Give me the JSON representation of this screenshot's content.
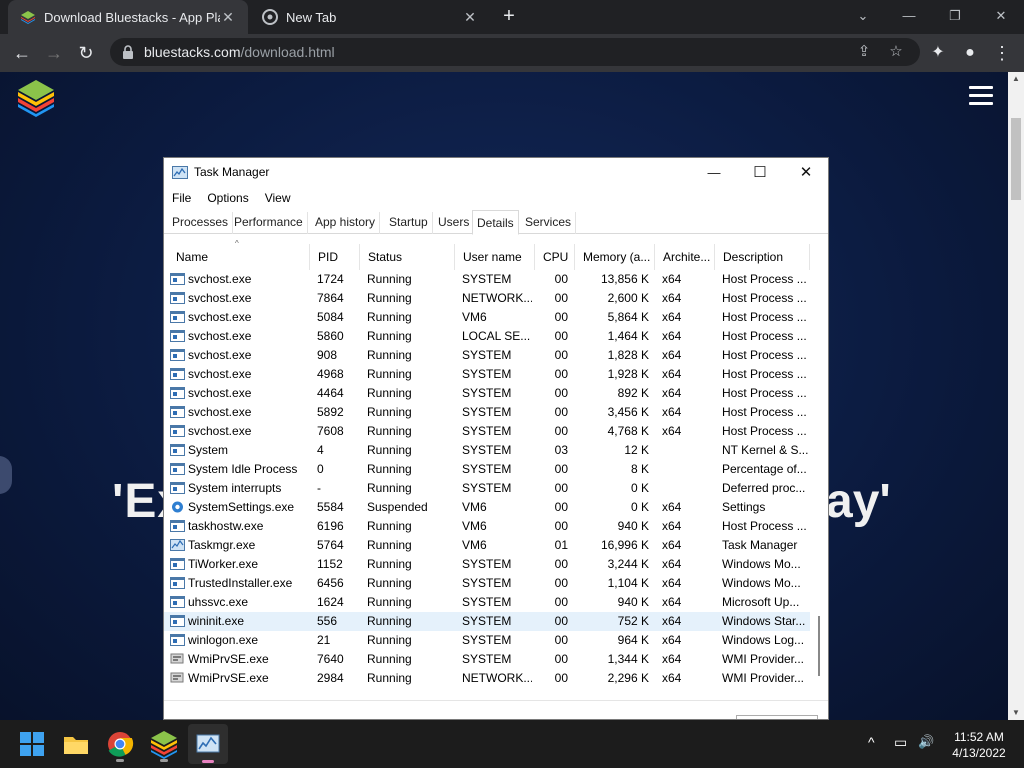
{
  "browser": {
    "tabs": [
      {
        "title": "Download Bluestacks - App Playe",
        "close": "✕",
        "active": true
      },
      {
        "title": "New Tab",
        "close": "✕",
        "active": false
      }
    ],
    "new_tab": "+",
    "window_controls": {
      "dropdown": "⌄",
      "minimize": "—",
      "restore": "❐",
      "close": "✕"
    },
    "nav": {
      "back": "←",
      "forward": "→",
      "reload": "↻"
    },
    "address": {
      "host": "bluestacks.com",
      "path": "/download.html"
    },
    "toolbar_icons": {
      "share": "⇪",
      "bookmark": "☆",
      "extensions": "✦",
      "profile": "●",
      "menu": "⋮"
    }
  },
  "page": {
    "hero_left": "'Ex",
    "hero_right": "ay'",
    "scroll_up": "▲",
    "scroll_down": "▼"
  },
  "task_manager": {
    "title": "Task Manager",
    "window_controls": {
      "minimize": "—",
      "maximize": "☐",
      "close": "✕"
    },
    "menu": [
      "File",
      "Options",
      "View"
    ],
    "tabs": [
      "Processes",
      "Performance",
      "App history",
      "Startup",
      "Users",
      "Details",
      "Services"
    ],
    "selected_tab": "Details",
    "columns": [
      "Name",
      "PID",
      "Status",
      "User name",
      "CPU",
      "Memory (a...",
      "Archite...",
      "Description"
    ],
    "sort_indicator": "^",
    "rows": [
      {
        "icon": "service-icon",
        "name": "svchost.exe",
        "pid": "1724",
        "status": "Running",
        "user": "SYSTEM",
        "cpu": "00",
        "memory": "13,856 K",
        "arch": "x64",
        "desc": "Host Process ..."
      },
      {
        "icon": "service-icon",
        "name": "svchost.exe",
        "pid": "7864",
        "status": "Running",
        "user": "NETWORK...",
        "cpu": "00",
        "memory": "2,600 K",
        "arch": "x64",
        "desc": "Host Process ..."
      },
      {
        "icon": "service-icon",
        "name": "svchost.exe",
        "pid": "5084",
        "status": "Running",
        "user": "VM6",
        "cpu": "00",
        "memory": "5,864 K",
        "arch": "x64",
        "desc": "Host Process ..."
      },
      {
        "icon": "service-icon",
        "name": "svchost.exe",
        "pid": "5860",
        "status": "Running",
        "user": "LOCAL SE...",
        "cpu": "00",
        "memory": "1,464 K",
        "arch": "x64",
        "desc": "Host Process ..."
      },
      {
        "icon": "service-icon",
        "name": "svchost.exe",
        "pid": "908",
        "status": "Running",
        "user": "SYSTEM",
        "cpu": "00",
        "memory": "1,828 K",
        "arch": "x64",
        "desc": "Host Process ..."
      },
      {
        "icon": "service-icon",
        "name": "svchost.exe",
        "pid": "4968",
        "status": "Running",
        "user": "SYSTEM",
        "cpu": "00",
        "memory": "1,928 K",
        "arch": "x64",
        "desc": "Host Process ..."
      },
      {
        "icon": "service-icon",
        "name": "svchost.exe",
        "pid": "4464",
        "status": "Running",
        "user": "SYSTEM",
        "cpu": "00",
        "memory": "892 K",
        "arch": "x64",
        "desc": "Host Process ..."
      },
      {
        "icon": "service-icon",
        "name": "svchost.exe",
        "pid": "5892",
        "status": "Running",
        "user": "SYSTEM",
        "cpu": "00",
        "memory": "3,456 K",
        "arch": "x64",
        "desc": "Host Process ..."
      },
      {
        "icon": "service-icon",
        "name": "svchost.exe",
        "pid": "7608",
        "status": "Running",
        "user": "SYSTEM",
        "cpu": "00",
        "memory": "4,768 K",
        "arch": "x64",
        "desc": "Host Process ..."
      },
      {
        "icon": "service-icon",
        "name": "System",
        "pid": "4",
        "status": "Running",
        "user": "SYSTEM",
        "cpu": "03",
        "memory": "12 K",
        "arch": "",
        "desc": "NT Kernel & S..."
      },
      {
        "icon": "service-icon",
        "name": "System Idle Process",
        "pid": "0",
        "status": "Running",
        "user": "SYSTEM",
        "cpu": "00",
        "memory": "8 K",
        "arch": "",
        "desc": "Percentage of..."
      },
      {
        "icon": "service-icon",
        "name": "System interrupts",
        "pid": "-",
        "status": "Running",
        "user": "SYSTEM",
        "cpu": "00",
        "memory": "0 K",
        "arch": "",
        "desc": "Deferred proc..."
      },
      {
        "icon": "gear-icon",
        "name": "SystemSettings.exe",
        "pid": "5584",
        "status": "Suspended",
        "user": "VM6",
        "cpu": "00",
        "memory": "0 K",
        "arch": "x64",
        "desc": "Settings"
      },
      {
        "icon": "service-icon",
        "name": "taskhostw.exe",
        "pid": "6196",
        "status": "Running",
        "user": "VM6",
        "cpu": "00",
        "memory": "940 K",
        "arch": "x64",
        "desc": "Host Process ..."
      },
      {
        "icon": "taskmgr-icon",
        "name": "Taskmgr.exe",
        "pid": "5764",
        "status": "Running",
        "user": "VM6",
        "cpu": "01",
        "memory": "16,996 K",
        "arch": "x64",
        "desc": "Task Manager"
      },
      {
        "icon": "service-icon",
        "name": "TiWorker.exe",
        "pid": "1152",
        "status": "Running",
        "user": "SYSTEM",
        "cpu": "00",
        "memory": "3,244 K",
        "arch": "x64",
        "desc": "Windows Mo..."
      },
      {
        "icon": "service-icon",
        "name": "TrustedInstaller.exe",
        "pid": "6456",
        "status": "Running",
        "user": "SYSTEM",
        "cpu": "00",
        "memory": "1,104 K",
        "arch": "x64",
        "desc": "Windows Mo..."
      },
      {
        "icon": "service-icon",
        "name": "uhssvc.exe",
        "pid": "1624",
        "status": "Running",
        "user": "SYSTEM",
        "cpu": "00",
        "memory": "940 K",
        "arch": "x64",
        "desc": "Microsoft Up..."
      },
      {
        "icon": "service-icon",
        "name": "wininit.exe",
        "pid": "556",
        "status": "Running",
        "user": "SYSTEM",
        "cpu": "00",
        "memory": "752 K",
        "arch": "x64",
        "desc": "Windows Star...",
        "selected": true
      },
      {
        "icon": "service-icon",
        "name": "winlogon.exe",
        "pid": "21",
        "status": "Running",
        "user": "SYSTEM",
        "cpu": "00",
        "memory": "964 K",
        "arch": "x64",
        "desc": "Windows Log..."
      },
      {
        "icon": "wmi-icon",
        "name": "WmiPrvSE.exe",
        "pid": "7640",
        "status": "Running",
        "user": "SYSTEM",
        "cpu": "00",
        "memory": "1,344 K",
        "arch": "x64",
        "desc": "WMI Provider..."
      },
      {
        "icon": "wmi-icon",
        "name": "WmiPrvSE.exe",
        "pid": "2984",
        "status": "Running",
        "user": "NETWORK...",
        "cpu": "00",
        "memory": "2,296 K",
        "arch": "x64",
        "desc": "WMI Provider..."
      }
    ]
  },
  "taskbar": {
    "apps": [
      "start-icon",
      "file-explorer-icon",
      "chrome-icon",
      "bluestacks-icon",
      "task-manager-icon"
    ],
    "active_app": "task-manager-icon",
    "tray": {
      "chevron": "^",
      "network": "▭",
      "volume": "🔊"
    },
    "time": "11:52 AM",
    "date": "4/13/2022"
  }
}
